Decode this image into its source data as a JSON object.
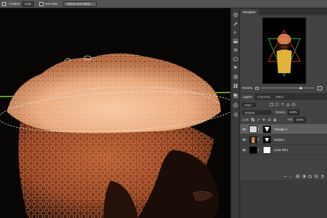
{
  "options_bar": {
    "feather_label": "Feather:",
    "feather_value": "0 px",
    "anti_alias_label": "Anti-alias",
    "select_mask_label": "Select and Mask..."
  },
  "navigator": {
    "tab_label": "Navigator",
    "zoom": "99.66%",
    "zoom_slider_fraction": 0.75
  },
  "layers_panel": {
    "tabs": [
      "Layers",
      "Channels",
      "Paths"
    ],
    "filter_kind": "Kind",
    "blend_mode": "Normal",
    "opacity_label": "Opacity:",
    "opacity_value": "100%",
    "lock_label": "Lock:",
    "fill_label": "Fill:",
    "fill_value": "100%",
    "layers": [
      {
        "name": "Triangle 1",
        "selected": true
      },
      {
        "name": "Subject",
        "selected": false
      },
      {
        "name": "Color Fill 1",
        "selected": false
      }
    ]
  },
  "colors": {
    "app_bg": "#535353",
    "panel_bg": "#424242",
    "selected_row": "#5f5f5f",
    "guide_green": "#7ed321",
    "hair_orange": "#c8734a",
    "triangle_red": "#d6402a",
    "triangle_green": "#34c64a"
  },
  "toolbar_icons": [
    "history-icon",
    "brush-presets-icon",
    "character-icon",
    "adjustments-icon",
    "properties-icon",
    "3d-icon",
    "play-icon",
    "libraries-icon",
    "swatches-icon",
    "color-icon",
    "info-icon",
    "paragraph-icon"
  ]
}
